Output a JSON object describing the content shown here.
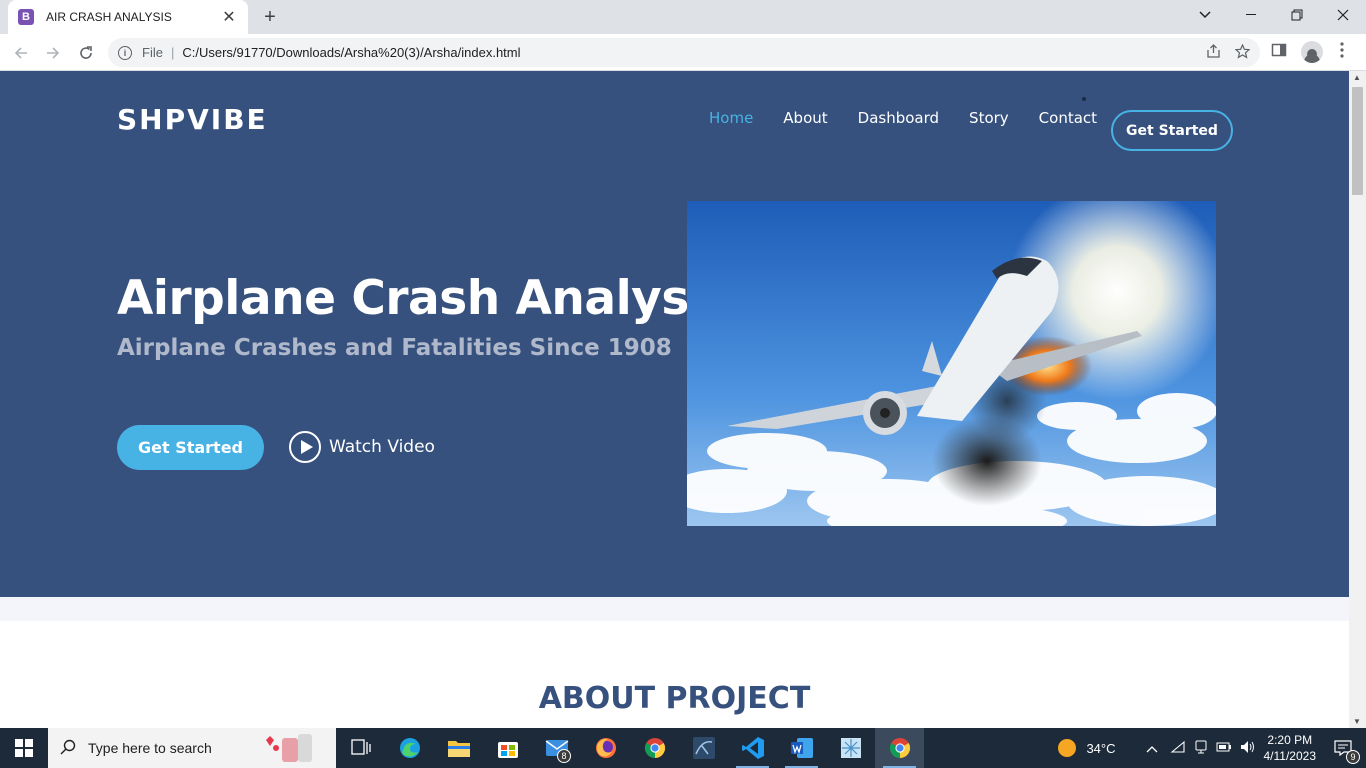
{
  "browser": {
    "tab_title": "AIR CRASH ANALYSIS",
    "tab_favicon": "B",
    "url_scheme_label": "File",
    "url": "C:/Users/91770/Downloads/Arsha%20(3)/Arsha/index.html"
  },
  "site": {
    "brand": "SHPVIBE",
    "nav": [
      {
        "label": "Home",
        "active": true
      },
      {
        "label": "About"
      },
      {
        "label": "Dashboard"
      },
      {
        "label": "Story"
      },
      {
        "label": "Contact"
      }
    ],
    "nav_cta": "Get Started",
    "hero": {
      "title": "Airplane Crash Analysis",
      "subtitle": "Airplane Crashes and Fatalities Since 1908",
      "primary_button": "Get Started",
      "video_button": "Watch Video"
    },
    "about_title": "ABOUT PROJECT",
    "colors": {
      "hero_bg": "#37517e",
      "accent": "#47b2e4"
    }
  },
  "taskbar": {
    "search_placeholder": "Type here to search",
    "mail_badge": "8",
    "weather": "34°C",
    "time": "2:20 PM",
    "date": "4/11/2023",
    "notification_count": "9"
  }
}
